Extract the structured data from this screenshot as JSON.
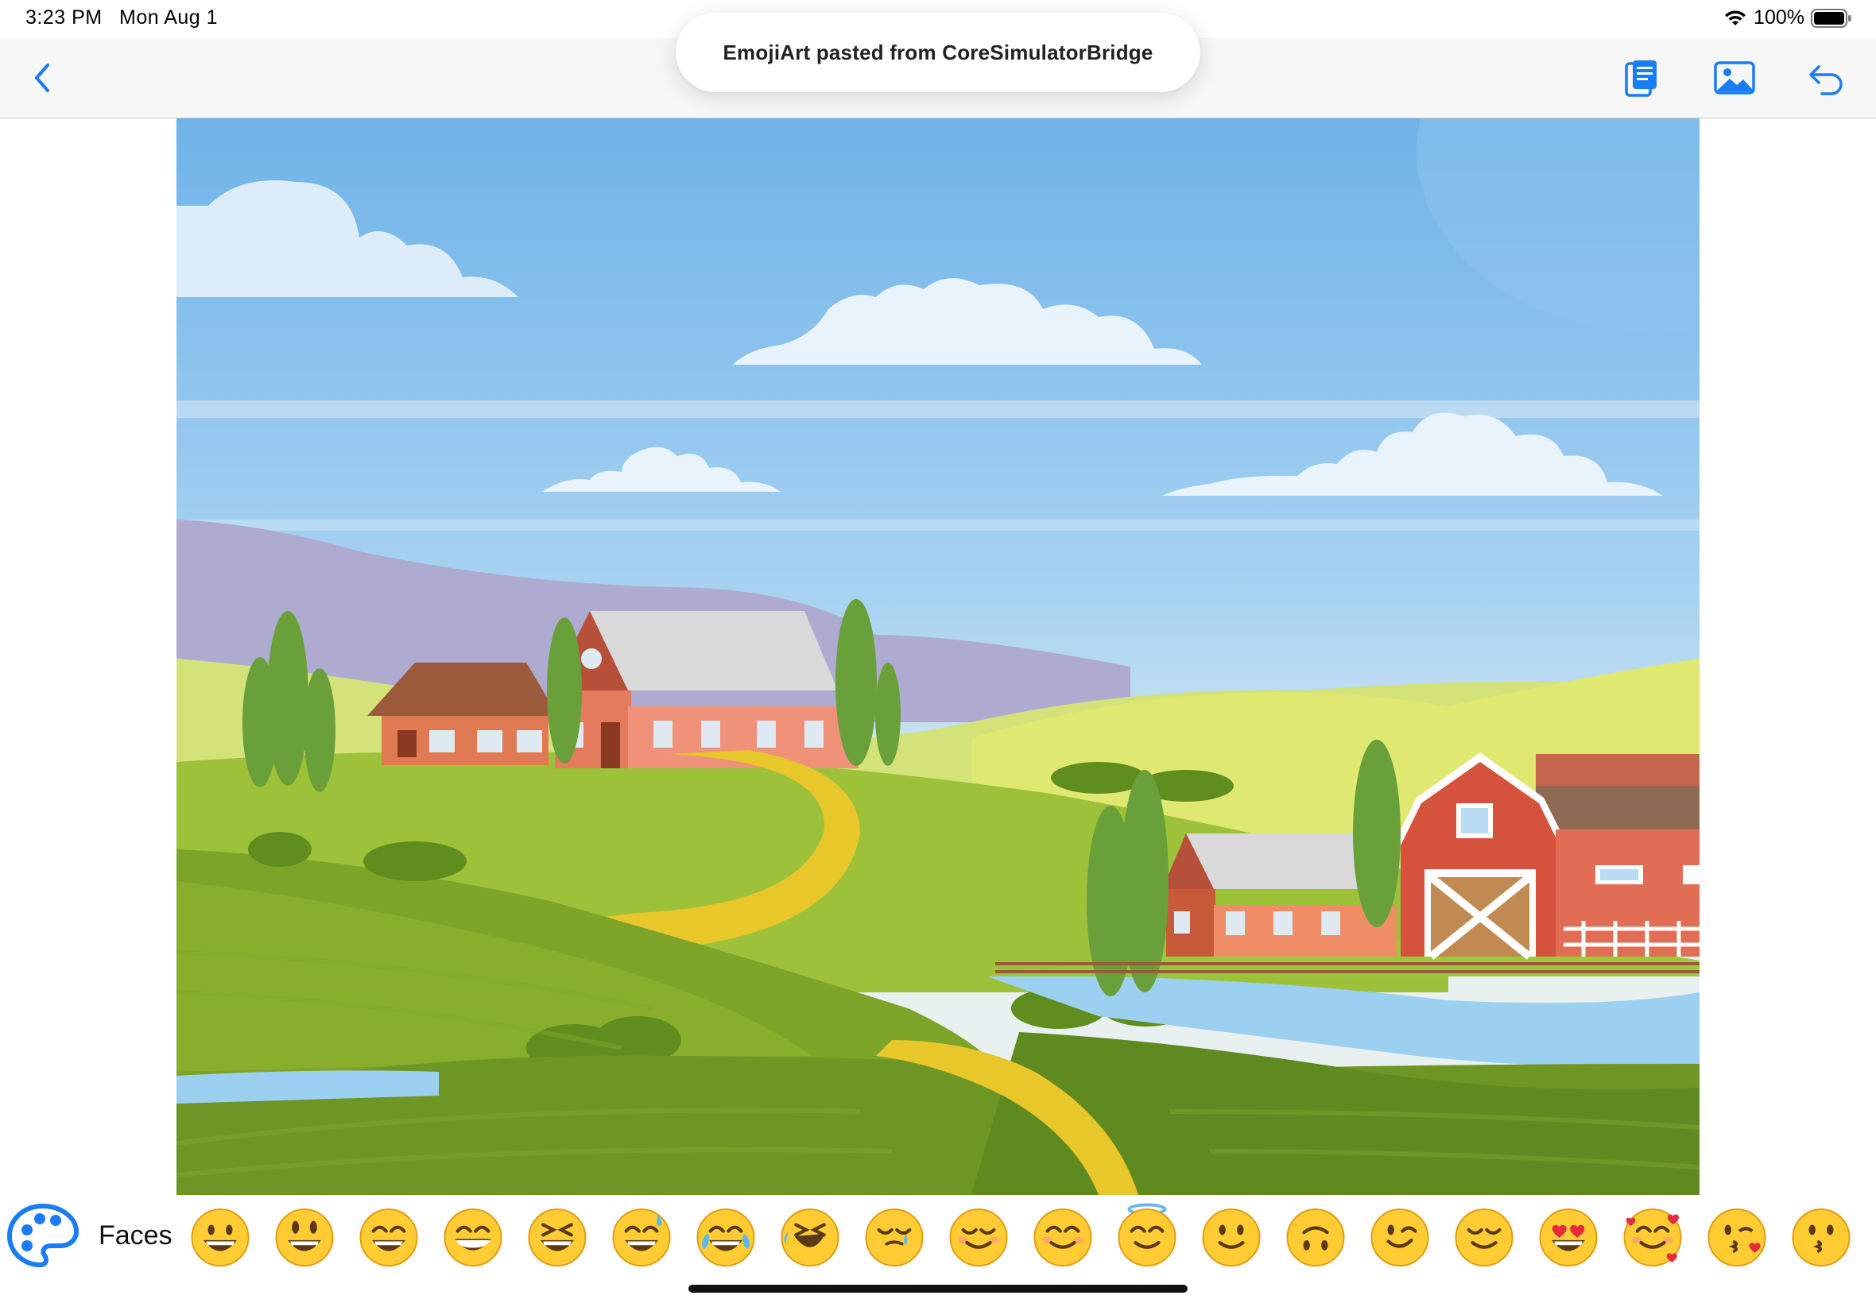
{
  "status_bar": {
    "time": "3:23 PM",
    "date": "Mon Aug 1",
    "battery": "100%"
  },
  "toast": {
    "message": "EmojiArt pasted from CoreSimulatorBridge"
  },
  "toolbar": {
    "back_icon": "chevron-left-icon",
    "paste_icon": "clipboard-icon",
    "photo_icon": "photo-icon",
    "undo_icon": "undo-arrow-icon",
    "accent_color": "#1a7cf5"
  },
  "canvas": {
    "background": "farm landscape illustration"
  },
  "palette": {
    "name": "Faces",
    "icon": "paintpalette-icon",
    "emojis": [
      "😀",
      "😃",
      "😄",
      "😁",
      "😆",
      "😅",
      "😂",
      "🤣",
      "🥲",
      "☺️",
      "😊",
      "😇",
      "🙂",
      "🙃",
      "😉",
      "😌",
      "😍",
      "🥰",
      "😘",
      "😗"
    ]
  }
}
